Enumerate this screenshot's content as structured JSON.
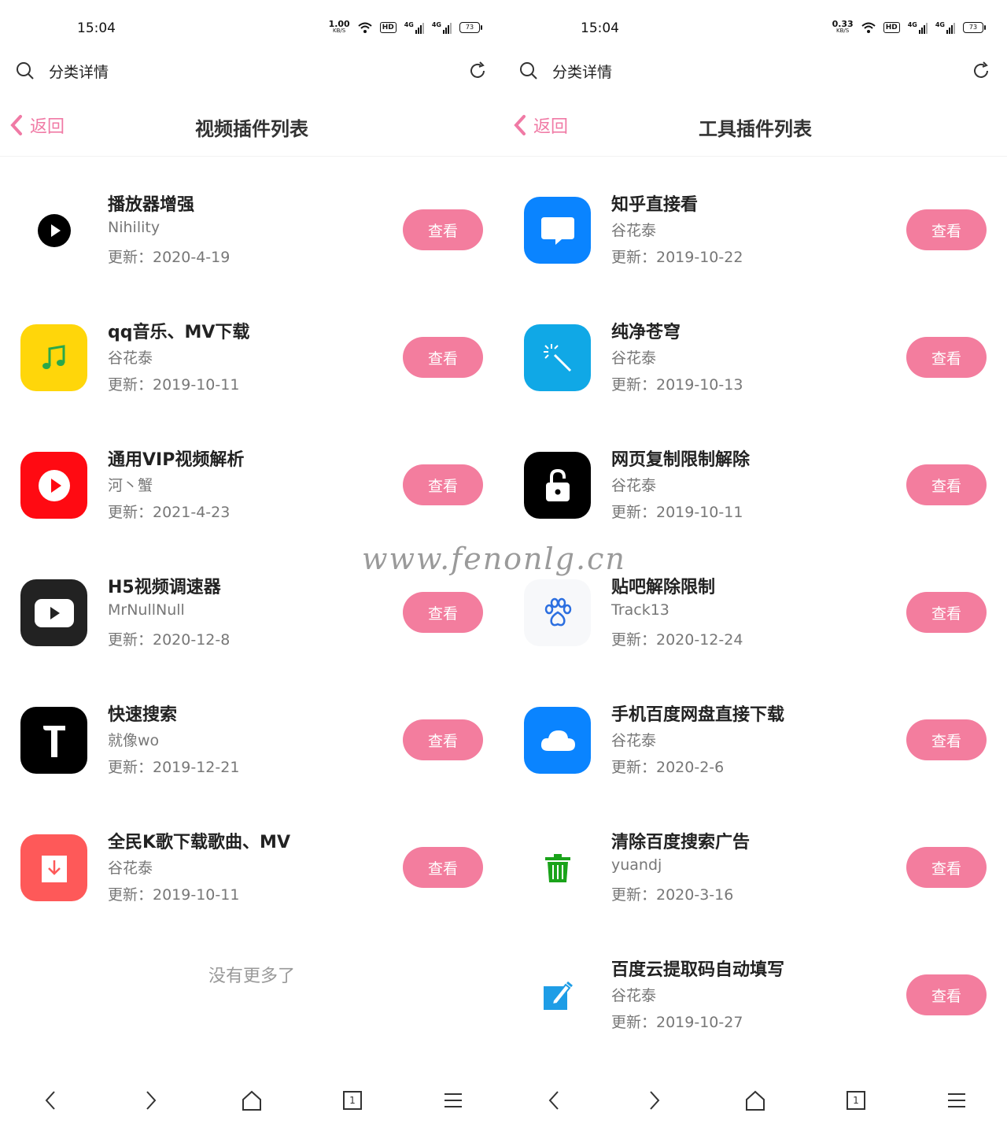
{
  "watermark": "www.fenonlg.cn",
  "left": {
    "status": {
      "time": "15:04",
      "rate": "1.00",
      "unit": "KB/S",
      "hd": "HD",
      "net1": "4G",
      "net2": "4G",
      "battery": "73"
    },
    "search_title": "分类详情",
    "back_label": "返回",
    "page_title": "视频插件列表",
    "items": [
      {
        "name": "播放器增强",
        "author": "Nihility",
        "update": "更新：2020-4-19",
        "button": "查看",
        "icon": "play-circle-icon"
      },
      {
        "name": "qq音乐、MV下载",
        "author": "谷花泰",
        "update": "更新：2019-10-11",
        "button": "查看",
        "icon": "music-note-icon"
      },
      {
        "name": "通用VIP视频解析",
        "author": "河丶蟹",
        "update": "更新：2021-4-23",
        "button": "查看",
        "icon": "play-circle-icon"
      },
      {
        "name": "H5视频调速器",
        "author": "MrNullNull",
        "update": "更新：2020-12-8",
        "button": "查看",
        "icon": "play-rect-icon"
      },
      {
        "name": "快速搜索",
        "author": "就像wo",
        "update": "更新：2019-12-21",
        "button": "查看",
        "icon": "hammer-icon"
      },
      {
        "name": "全民K歌下载歌曲、MV",
        "author": "谷花泰",
        "update": "更新：2019-10-11",
        "button": "查看",
        "icon": "download-icon"
      }
    ],
    "no_more": "没有更多了"
  },
  "right": {
    "status": {
      "time": "15:04",
      "rate": "0.33",
      "unit": "KB/S",
      "hd": "HD",
      "net1": "4G",
      "net2": "4G",
      "battery": "73"
    },
    "search_title": "分类详情",
    "back_label": "返回",
    "page_title": "工具插件列表",
    "items": [
      {
        "name": "知乎直接看",
        "author": "谷花泰",
        "update": "更新：2019-10-22",
        "button": "查看",
        "icon": "chat-bubble-icon"
      },
      {
        "name": "纯净苍穹",
        "author": "谷花泰",
        "update": "更新：2019-10-13",
        "button": "查看",
        "icon": "magic-wand-icon"
      },
      {
        "name": "网页复制限制解除",
        "author": "谷花泰",
        "update": "更新：2019-10-11",
        "button": "查看",
        "icon": "unlock-icon"
      },
      {
        "name": "贴吧解除限制",
        "author": "Track13",
        "update": "更新：2020-12-24",
        "button": "查看",
        "icon": "paw-icon"
      },
      {
        "name": "手机百度网盘直接下载",
        "author": "谷花泰",
        "update": "更新：2020-2-6",
        "button": "查看",
        "icon": "cloud-icon"
      },
      {
        "name": "清除百度搜索广告",
        "author": "yuandj",
        "update": "更新：2020-3-16",
        "button": "查看",
        "icon": "trash-icon"
      },
      {
        "name": "百度云提取码自动填写",
        "author": "谷花泰",
        "update": "更新：2019-10-27",
        "button": "查看",
        "icon": "edit-icon"
      }
    ]
  },
  "bottom_nav": {
    "tab_count": "1"
  },
  "colors": {
    "accent": "#f37d9e",
    "back": "#f07aa5"
  }
}
